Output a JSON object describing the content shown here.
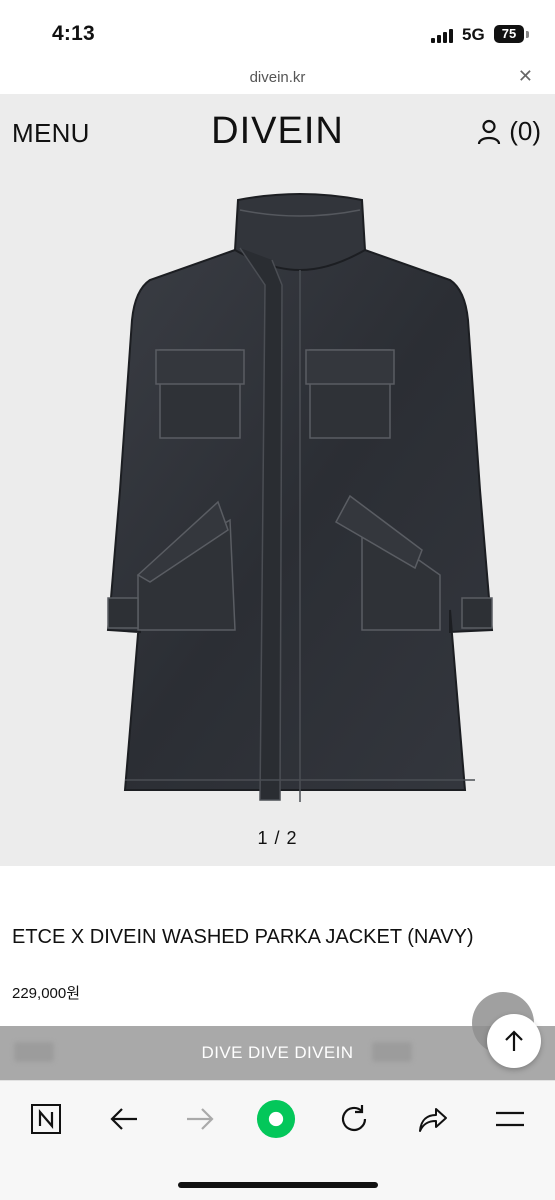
{
  "status_bar": {
    "time": "4:13",
    "network": "5G",
    "battery": "75"
  },
  "browser": {
    "url": "divein.kr",
    "close_icon": "close-icon"
  },
  "header": {
    "menu_label": "MENU",
    "logo": "DIVEIN",
    "cart_count": "(0)",
    "account_icon": "user-icon"
  },
  "gallery": {
    "counter": "1 / 2",
    "image": "navy washed parka jacket"
  },
  "product": {
    "name": "ETCE X DIVEIN WASHED PARKA JACKET (NAVY)",
    "price": "229,000원"
  },
  "marquee": {
    "text": "DIVE DIVE DIVEIN"
  },
  "floating": {
    "scroll_top_icon": "arrow-up-icon"
  },
  "toolbar": {
    "items": [
      "naver-icon",
      "back-icon",
      "forward-icon",
      "green-dot-icon",
      "refresh-icon",
      "share-icon",
      "menu-icon"
    ]
  },
  "colors": {
    "hero_bg": "#ececec",
    "marquee_bg": "#a9a9a9",
    "naver_green": "#03c75a"
  }
}
